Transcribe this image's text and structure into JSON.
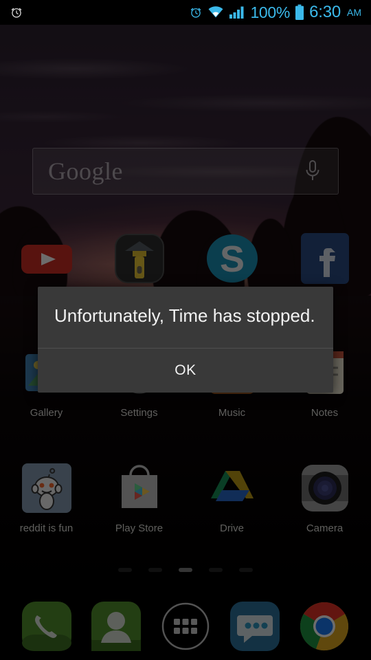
{
  "statusbar": {
    "left_icons": [
      {
        "name": "alarm-icon",
        "label": "alarm"
      }
    ],
    "alarm_icon": "alarm-icon",
    "wifi_icon": "wifi-icon",
    "signal_icon": "cellular-signal-icon",
    "battery_icon": "battery-full-icon",
    "battery_percent": "100%",
    "time": "6:30",
    "ampm": "AM",
    "accent_color": "#3bb9ea",
    "background_color": "#000000"
  },
  "search_widget": {
    "brand": "Google",
    "mic_icon": "microphone-icon",
    "placeholder": "Google"
  },
  "home": {
    "rows": [
      {
        "apps": [
          {
            "label": "",
            "icon": "youtube-icon"
          },
          {
            "label": "",
            "icon": "flashlight-icon"
          },
          {
            "label": "",
            "icon": "skype-icon"
          },
          {
            "label": "",
            "icon": "facebook-icon"
          }
        ]
      },
      {
        "apps": [
          {
            "label": "Gallery",
            "icon": "gallery-icon"
          },
          {
            "label": "Settings",
            "icon": "settings-icon"
          },
          {
            "label": "Music",
            "icon": "music-icon"
          },
          {
            "label": "Notes",
            "icon": "notes-icon"
          }
        ]
      },
      {
        "apps": [
          {
            "label": "reddit is fun",
            "icon": "reddit-icon"
          },
          {
            "label": "Play Store",
            "icon": "play-store-icon"
          },
          {
            "label": "Drive",
            "icon": "google-drive-icon"
          },
          {
            "label": "Camera",
            "icon": "camera-icon"
          }
        ]
      }
    ],
    "page_indicator": {
      "count": 5,
      "active_index": 2
    }
  },
  "dock": {
    "items": [
      {
        "name": "phone",
        "icon": "phone-icon"
      },
      {
        "name": "contacts",
        "icon": "contacts-icon"
      },
      {
        "name": "app-drawer",
        "icon": "app-drawer-icon"
      },
      {
        "name": "messaging",
        "icon": "messaging-icon"
      },
      {
        "name": "chrome",
        "icon": "chrome-icon"
      }
    ]
  },
  "dialog": {
    "message": "Unfortunately, Time has stopped.",
    "ok_label": "OK",
    "background_color": "#393939",
    "text_color": "#f2f2f2"
  }
}
